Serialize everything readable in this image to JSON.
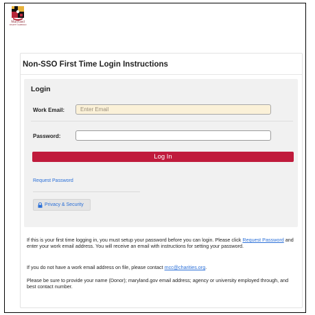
{
  "logo": {
    "text": "Maryland",
    "subtext": "CHARITY CAMPAIGN"
  },
  "card": {
    "title": "Non-SSO First Time Login Instructions"
  },
  "login": {
    "title": "Login",
    "email_label": "Work Email:",
    "email_placeholder": "Enter Email",
    "email_value": "",
    "password_label": "Password:",
    "password_value": "",
    "button_label": "Log In",
    "request_password_label": "Request Password",
    "privacy_label": "Privacy & Security"
  },
  "instructions": {
    "p1_before": "If this is your first time logging in, you must setup your password before you can login. Please click ",
    "p1_link": "Request Password",
    "p1_after": " and enter your work email address. You will receive an email with instructions for setting your password.",
    "p2_before": "If you do not have a work email address on file, please contact ",
    "p2_link": "mcc@charities.org",
    "p2_after": ".",
    "p3": "Please be sure to provide your name (Donor); maryland.gov email address; agency or university employed through, and best contact number."
  },
  "colors": {
    "accent": "#c01b3c",
    "link": "#2a6fd8",
    "panel": "#f1f1f1",
    "email_fill": "#fbf1d8"
  }
}
